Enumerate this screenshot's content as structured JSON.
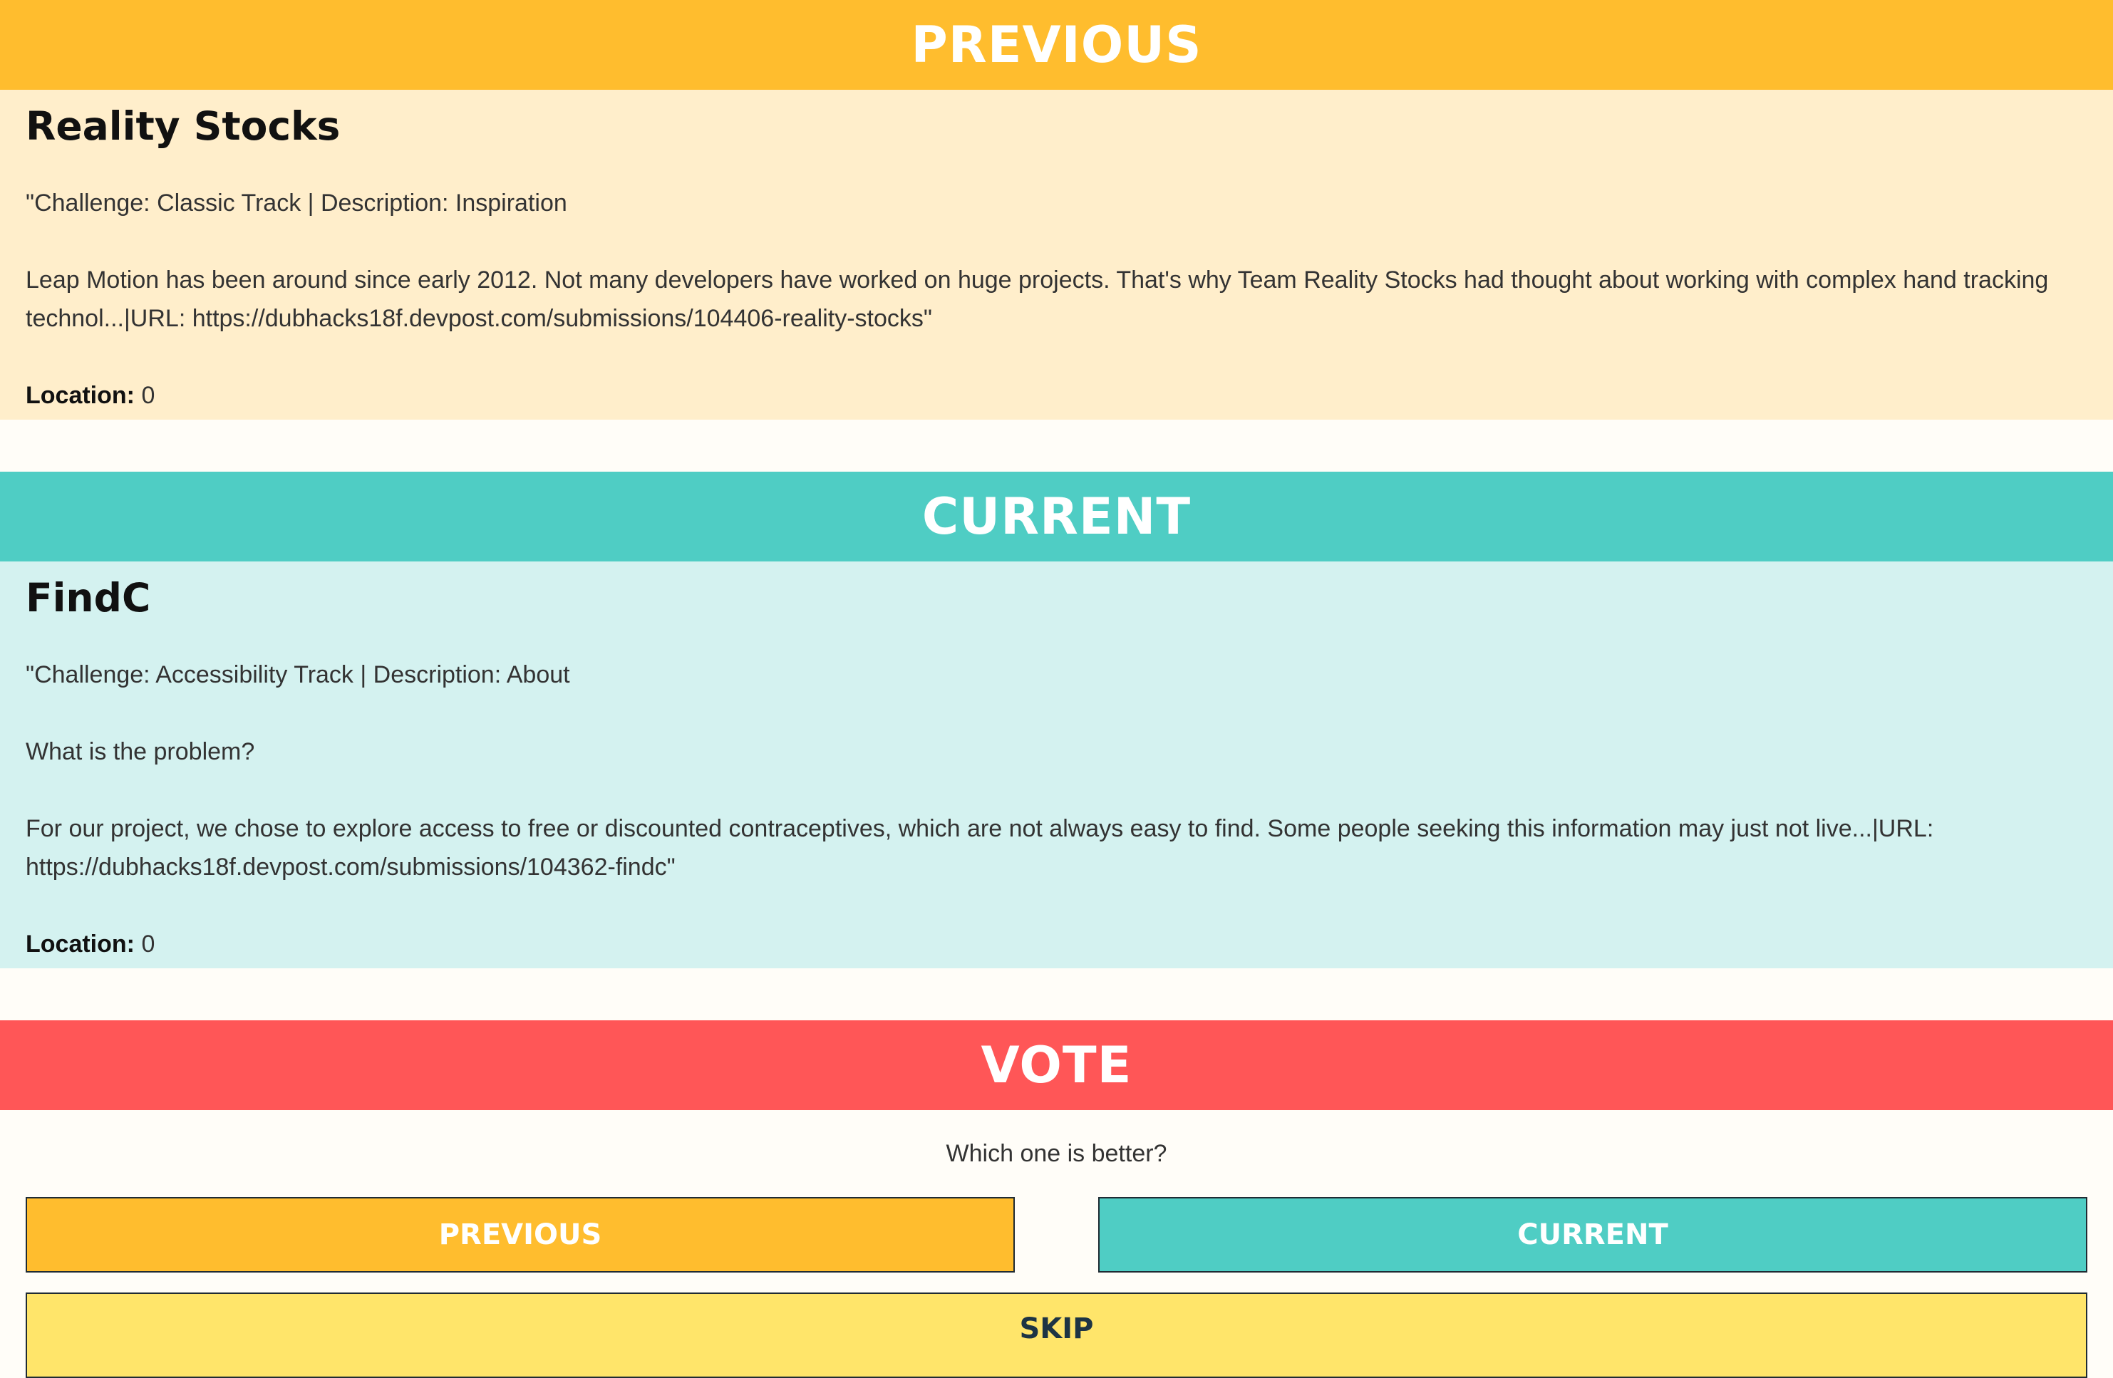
{
  "sections": {
    "previous_header": "PREVIOUS",
    "current_header": "CURRENT",
    "vote_header": "VOTE"
  },
  "previous": {
    "title": "Reality Stocks",
    "challenge_line": "\"Challenge: Classic Track | Description: Inspiration",
    "description": "Leap Motion has been around since early 2012. Not many developers have worked on huge projects. That's why Team Reality Stocks had thought about working with complex hand tracking technol...|URL: https://dubhacks18f.devpost.com/submissions/104406-reality-stocks\"",
    "location_label": "Location:",
    "location_value": "0"
  },
  "current": {
    "title": "FindC",
    "challenge_line": "\"Challenge: Accessibility Track | Description: About",
    "question_line": "What is the problem?",
    "description": "For our project, we chose to explore access to free or discounted contraceptives, which are not always easy to find. Some people seeking this information may just not live...|URL: https://dubhacks18f.devpost.com/submissions/104362-findc\"",
    "location_label": "Location:",
    "location_value": "0"
  },
  "vote": {
    "question": "Which one is better?",
    "previous_button": "PREVIOUS",
    "current_button": "CURRENT",
    "skip_button": "SKIP"
  },
  "colors": {
    "previous": "#ffbd2e",
    "current": "#4fcdc4",
    "vote": "#ff5657",
    "skip": "#ffe56a"
  }
}
